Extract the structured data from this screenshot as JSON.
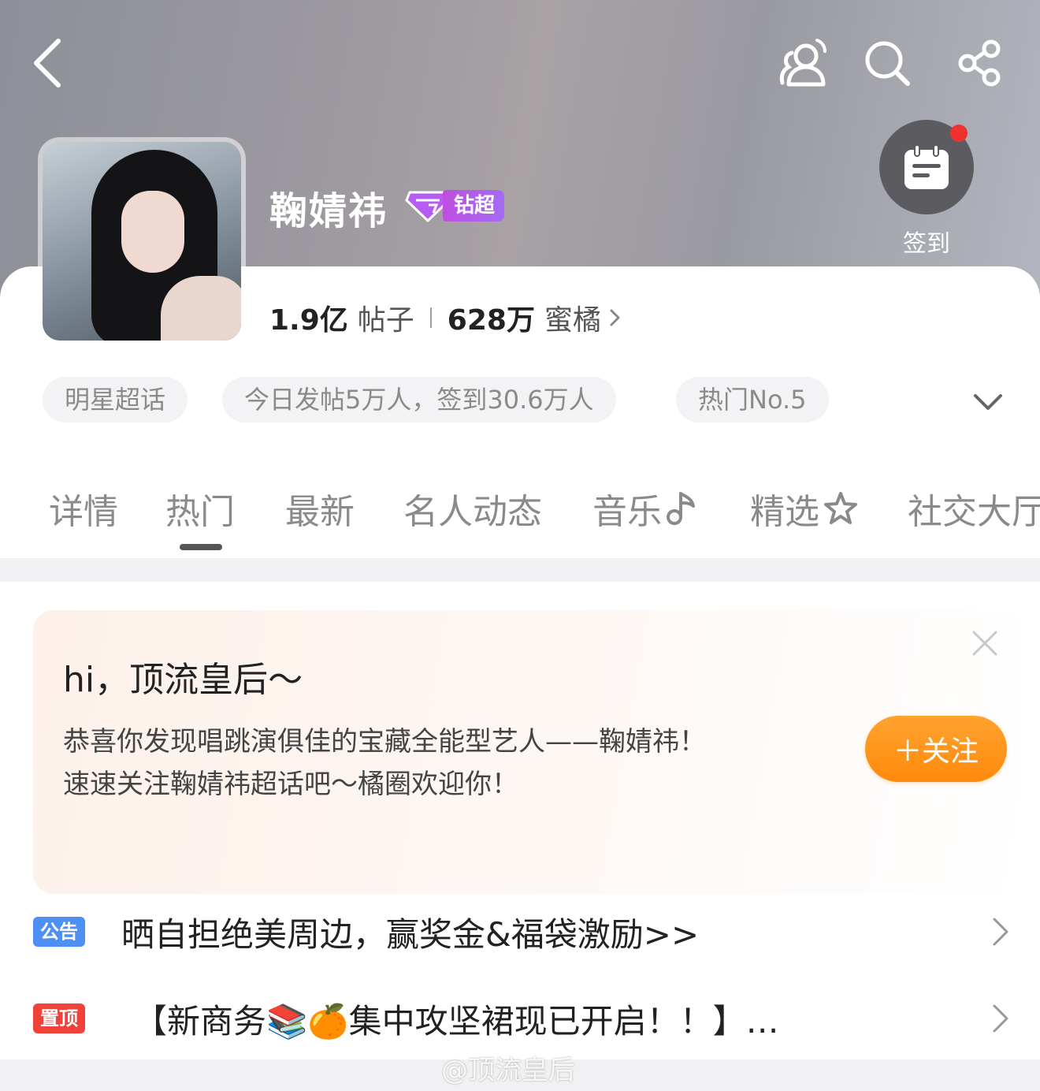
{
  "header": {
    "name": "鞠婧祎",
    "vip_label": "钻超",
    "checkin_label": "签到",
    "icons": [
      "back-icon",
      "group-icon",
      "search-icon",
      "share-icon"
    ]
  },
  "stats": {
    "posts_value": "1.9亿",
    "posts_unit": "帖子",
    "fans_value": "628万",
    "fans_unit": "蜜橘"
  },
  "tags": [
    "明星超话",
    "今日发帖5万人，签到30.6万人",
    "热门No.5"
  ],
  "tabs": [
    {
      "label": "详情"
    },
    {
      "label": "热门",
      "active": true
    },
    {
      "label": "最新"
    },
    {
      "label": "名人动态"
    },
    {
      "label": "音乐"
    },
    {
      "label": "精选"
    },
    {
      "label": "社交大厅"
    }
  ],
  "welcome": {
    "title": "hi，顶流皇后～",
    "line1": "恭喜你发现唱跳演俱佳的宝藏全能型艺人——鞠婧祎！",
    "line2": "速速关注鞠婧祎超话吧～橘圈欢迎你！",
    "follow_label": "＋关注"
  },
  "notices": [
    {
      "badge": "公告",
      "text": "晒自担绝美周边，赢奖金&福袋激励>>"
    },
    {
      "badge": "置顶",
      "text": "【新商务📚🍊集中攻坚裙现已开启！！】…"
    }
  ],
  "watermark": "@顶流皇后",
  "colors": {
    "accent_orange": "#ff9a1f",
    "badge_blue": "#4d8ff3",
    "badge_red": "#f04238",
    "vip_purple": "#b35ae8"
  }
}
